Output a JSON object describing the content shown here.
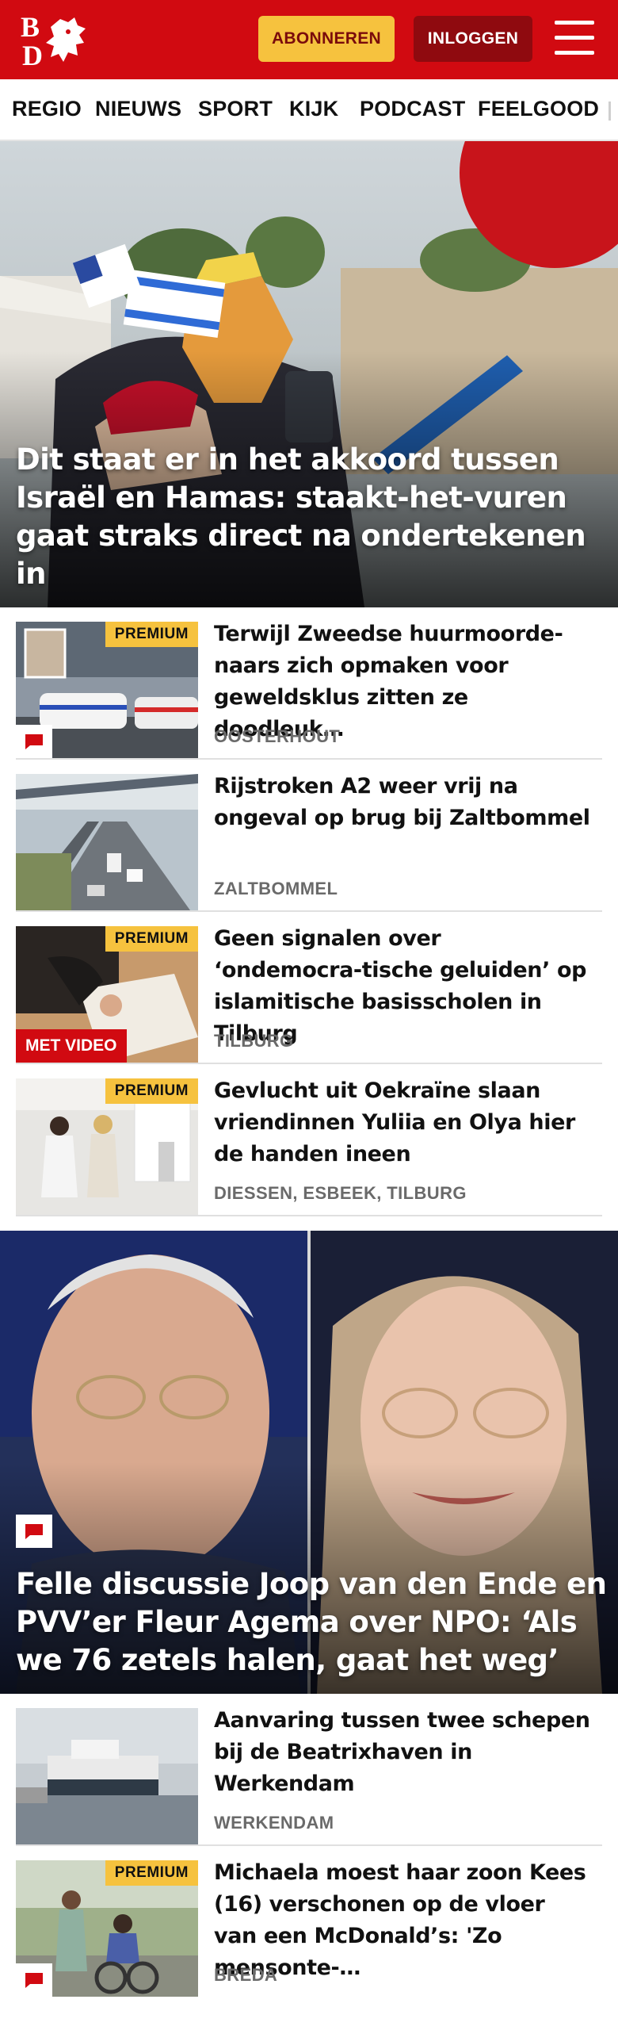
{
  "header": {
    "subscribe_label": "ABONNEREN",
    "login_label": "INLOGGEN",
    "brand_color": "#d10a11",
    "accent_color": "#f6c23e"
  },
  "nav": {
    "items": [
      "REGIO",
      "NIEUWS",
      "SPORT",
      "KIJK",
      "PODCAST",
      "FEELGOOD"
    ]
  },
  "hero": {
    "title": "Dit staat er in het akkoord tussen Israël en Hamas: staakt-het-vuren gaat straks direct na ondertekenen in"
  },
  "articles": [
    {
      "title": "Terwijl Zweedse huurmoorde-naars zich opmaken voor geweldsklus zitten ze doodleuk…",
      "location": "OOSTERHOUT",
      "premium": "PREMIUM"
    },
    {
      "title": "Rijstroken A2 weer vrij na ongeval op brug bij Zaltbommel",
      "location": "ZALTBOMMEL"
    },
    {
      "title": "Geen signalen over ‘ondemocra-tische geluiden’ op islamitische basisscholen in Tilburg",
      "location": "TILBURG",
      "premium": "PREMIUM",
      "video": "MET VIDEO"
    },
    {
      "title": "Gevlucht uit Oekraïne slaan vriendinnen Yuliia en Olya hier de handen ineen",
      "location": "DIESSEN, ESBEEK, TILBURG",
      "premium": "PREMIUM"
    }
  ],
  "hero2": {
    "title": "Felle discussie Joop van den Ende en PVV’er Fleur Agema over NPO: ‘Als we 76 zetels halen, gaat het weg’"
  },
  "articles2": [
    {
      "title": "Aanvaring tussen twee schepen bij de Beatrixhaven in Werkendam",
      "location": "WERKENDAM"
    },
    {
      "title": "Michaela moest haar zoon Kees (16) verschonen op de vloer van een McDonald’s: 'Zo mensonte-…",
      "location": "BREDA",
      "premium": "PREMIUM"
    }
  ]
}
